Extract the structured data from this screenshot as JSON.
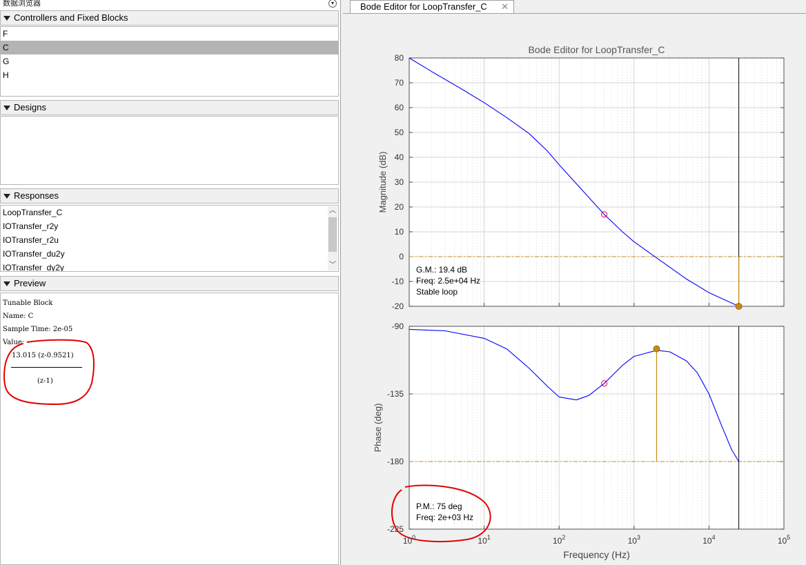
{
  "browser": {
    "title": "数据浏览器"
  },
  "controllers": {
    "header": "Controllers and Fixed Blocks",
    "items": [
      {
        "label": "F",
        "selected": false
      },
      {
        "label": "C",
        "selected": true
      },
      {
        "label": "G",
        "selected": false
      },
      {
        "label": "H",
        "selected": false
      }
    ]
  },
  "designs": {
    "header": "Designs"
  },
  "responses": {
    "header": "Responses",
    "items": [
      "LoopTransfer_C",
      "IOTransfer_r2y",
      "IOTransfer_r2u",
      "IOTransfer_du2y",
      "IOTransfer_dy2y"
    ]
  },
  "preview": {
    "header": "Preview",
    "line1": "Tunable Block",
    "line2": "Name: C",
    "line3": "Sample Time: 2e-05",
    "line4": "Value:",
    "numerator": "13.015 (z-0.9521)",
    "denominator": "(z-1)"
  },
  "tab": {
    "label": "Bode Editor for LoopTransfer_C",
    "close": "✕"
  },
  "colors": {
    "curve": "#0000ff",
    "margin": "#c88a16",
    "annotation": "#e00000",
    "marker_open": "#e0004a"
  },
  "chart_data": {
    "type": "line",
    "title": "Bode Editor for LoopTransfer_C",
    "xlabel": "Frequency (Hz)",
    "x_scale": "log",
    "xlim": [
      1,
      100000
    ],
    "x_ticks": [
      "10^0",
      "10^1",
      "10^2",
      "10^3",
      "10^4",
      "10^5"
    ],
    "magnitude": {
      "ylabel": "Magnitude (dB)",
      "ylim": [
        -20,
        80
      ],
      "y_ticks": [
        80,
        70,
        60,
        50,
        40,
        30,
        20,
        10,
        0,
        -10,
        -20
      ],
      "x": [
        1,
        2,
        5,
        10,
        20,
        40,
        70,
        100,
        200,
        400,
        700,
        1000,
        2000,
        5000,
        10000,
        25000
      ],
      "y": [
        80,
        74.5,
        67.5,
        62,
        56,
        49.5,
        42.5,
        37,
        27,
        17,
        10,
        6,
        -0.5,
        -9,
        -14.5,
        -20
      ],
      "operating_point": {
        "x": 400,
        "y": 17
      },
      "gain_margin_point": {
        "x": 25000,
        "y": -20
      },
      "annotation": [
        "G.M.: 19.4 dB",
        "Freq: 2.5e+04 Hz",
        "Stable loop"
      ]
    },
    "phase": {
      "ylabel": "Phase (deg)",
      "ylim": [
        -225,
        -90
      ],
      "y_ticks": [
        -90,
        -135,
        -180,
        -225
      ],
      "x": [
        1,
        3,
        10,
        20,
        40,
        70,
        100,
        170,
        250,
        400,
        700,
        1000,
        2000,
        3000,
        5000,
        7000,
        10000,
        15000,
        20000,
        25000
      ],
      "y": [
        -92,
        -93,
        -98,
        -105,
        -118,
        -130,
        -137,
        -139,
        -136,
        -128,
        -116,
        -110,
        -106,
        -107,
        -113,
        -121,
        -135,
        -157,
        -172,
        -180
      ],
      "operating_point": {
        "x": 400,
        "y": -128
      },
      "phase_margin_point": {
        "x": 2000,
        "y": -105
      },
      "crossing_line_x": 25000,
      "reference_y": -180,
      "annotation": [
        "P.M.: 75 deg",
        "Freq: 2e+03 Hz"
      ]
    }
  }
}
